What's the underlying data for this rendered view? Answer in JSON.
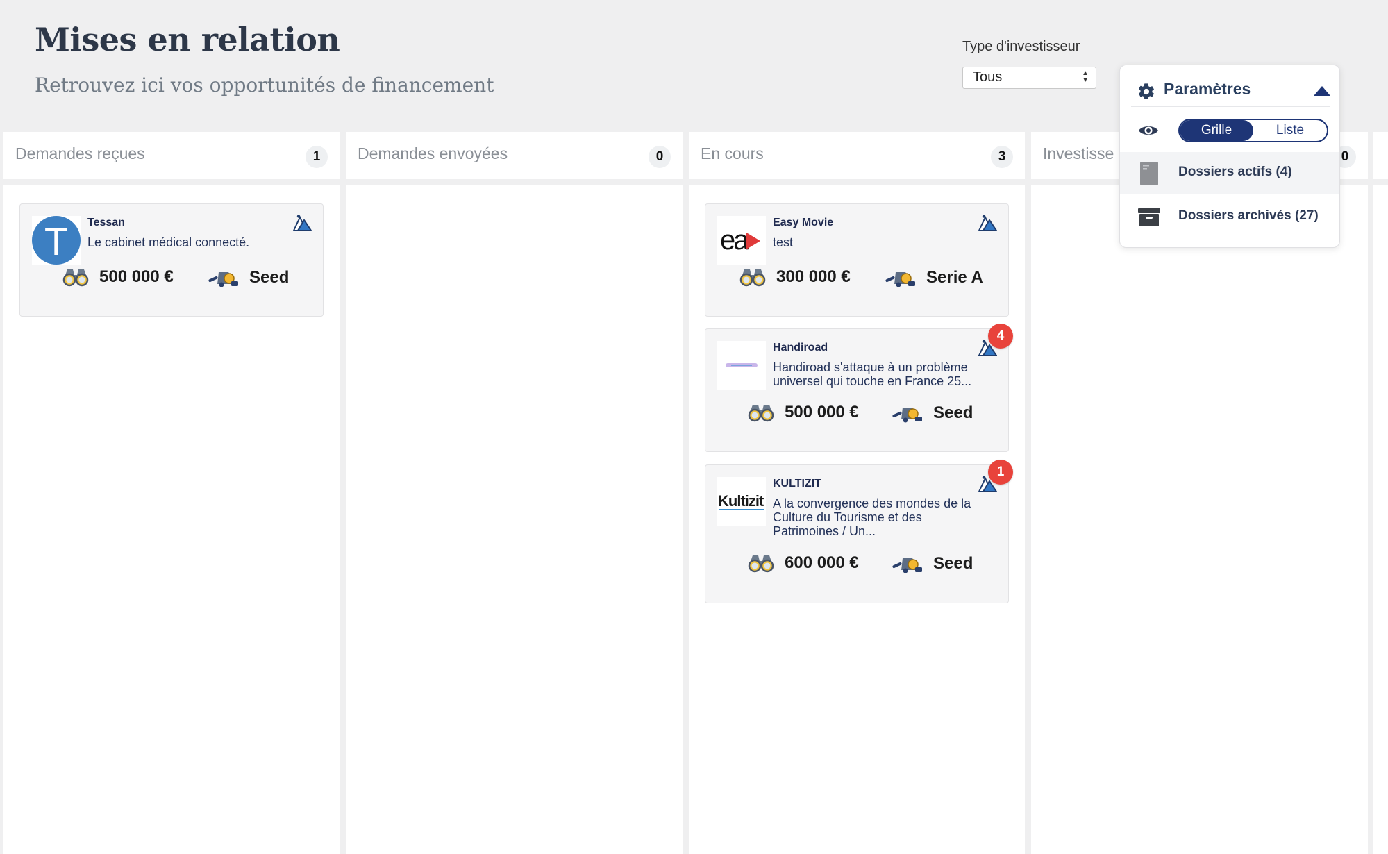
{
  "header": {
    "title": "Mises en relation",
    "subtitle": "Retrouvez ici vos opportunités de financement"
  },
  "filter": {
    "label": "Type d'investisseur",
    "selected": "Tous"
  },
  "columns": [
    {
      "title": "Demandes reçues",
      "count": "1"
    },
    {
      "title": "Demandes envoyées",
      "count": "0"
    },
    {
      "title": "En cours",
      "count": "3"
    },
    {
      "title": "Investisse",
      "count": "0"
    }
  ],
  "cards": [
    {
      "name": "Tessan",
      "description": "Le cabinet médical connecté.",
      "amount": "500 000 €",
      "stage": "Seed",
      "badge": null,
      "logo": "T"
    },
    {
      "name": "Easy Movie",
      "description": "test",
      "amount": "300 000 €",
      "stage": "Serie A",
      "badge": null,
      "logo": "ea"
    },
    {
      "name": "Handiroad",
      "description": "Handiroad s'attaque à un problème universel qui touche en France 25...",
      "amount": "500 000 €",
      "stage": "Seed",
      "badge": "4",
      "logo": "handiroad"
    },
    {
      "name": "KULTIZIT",
      "description": "A la convergence des mondes de la Culture du Tourisme et des Patrimoines / Un...",
      "amount": "600 000 €",
      "stage": "Seed",
      "badge": "1",
      "logo": "Kultizit"
    }
  ],
  "settings": {
    "title": "Paramètres",
    "view_toggle": {
      "grid": "Grille",
      "list": "Liste",
      "active": "Grille"
    },
    "active_folders": "Dossiers actifs (4)",
    "archived_folders": "Dossiers archivés (27)"
  },
  "colors": {
    "background": "#efeff0",
    "navy": "#1e3576",
    "badge_red": "#e8433b",
    "card_background": "#f5f5f6"
  },
  "icons": [
    "binoculars-icon",
    "investment-stage-icon",
    "mountain-icon",
    "gear-icon",
    "caret-up-icon",
    "eye-icon",
    "folder-icon",
    "archive-box-icon"
  ]
}
